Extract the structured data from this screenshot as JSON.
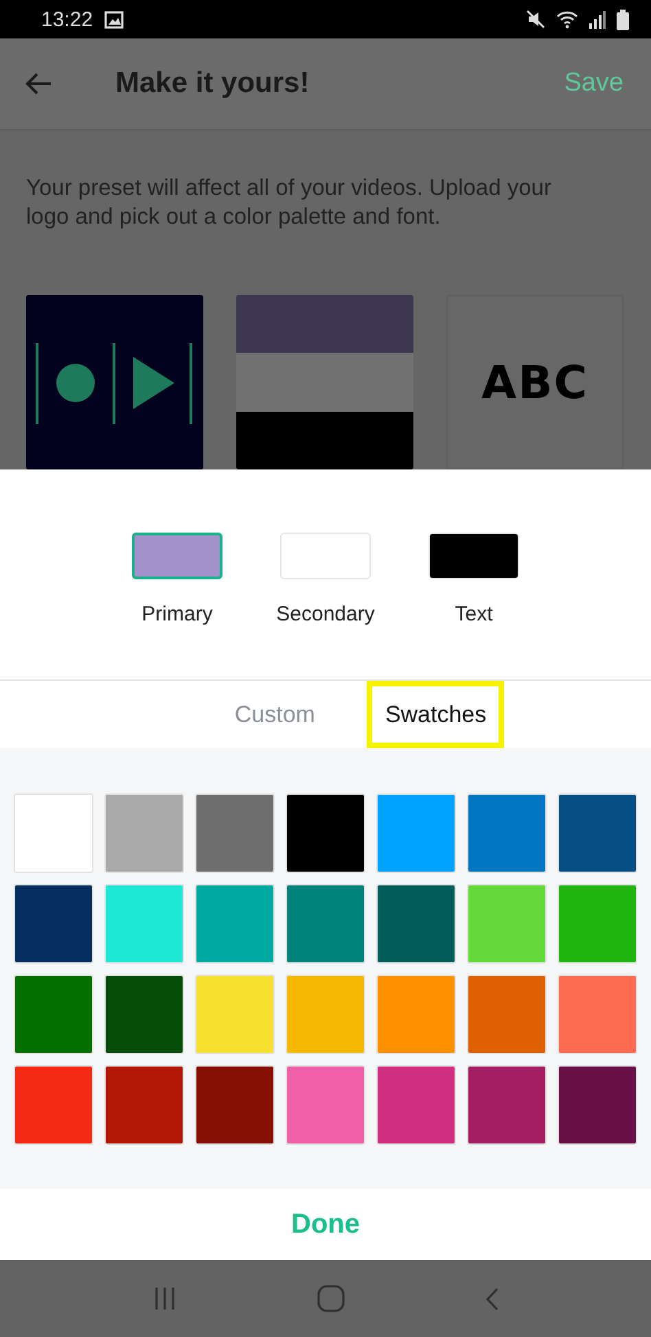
{
  "status_bar": {
    "time": "13:22"
  },
  "app_bar": {
    "title": "Make it yours!",
    "action": "Save"
  },
  "description": "Your preset will affect all of your videos. Upload your logo and pick out a color palette and font.",
  "previews": [
    {
      "kind": "logo"
    },
    {
      "kind": "palette",
      "stripes": [
        {
          "color": "#3d3651"
        },
        {
          "color": "#727272"
        },
        {
          "color": "#000000"
        }
      ]
    },
    {
      "kind": "font",
      "sample": "ABC"
    }
  ],
  "color_targets": [
    {
      "label": "Primary",
      "color": "#a292cc",
      "selected": true
    },
    {
      "label": "Secondary",
      "color": "#ffffff",
      "selected": false
    },
    {
      "label": "Text",
      "color": "#000000",
      "selected": false
    }
  ],
  "tabs": [
    {
      "label": "Custom",
      "selected": false,
      "highlighted": false
    },
    {
      "label": "Swatches",
      "selected": true,
      "highlighted": true
    }
  ],
  "swatches": [
    {
      "color": "#ffffff"
    },
    {
      "color": "#aaaaaa"
    },
    {
      "color": "#6e6e6e"
    },
    {
      "color": "#000000"
    },
    {
      "color": "#00a2ff"
    },
    {
      "color": "#0077c0"
    },
    {
      "color": "#064f85"
    },
    {
      "color": "#052f60"
    },
    {
      "color": "#1ee8d5"
    },
    {
      "color": "#00aaa0"
    },
    {
      "color": "#00827a"
    },
    {
      "color": "#005d5a"
    },
    {
      "color": "#63d93a"
    },
    {
      "color": "#1fb410"
    },
    {
      "color": "#047000"
    },
    {
      "color": "#054d08"
    },
    {
      "color": "#f8e030"
    },
    {
      "color": "#f5b800"
    },
    {
      "color": "#ff9000"
    },
    {
      "color": "#de6000"
    },
    {
      "color": "#ff6b50"
    },
    {
      "color": "#f52a14"
    },
    {
      "color": "#b31807"
    },
    {
      "color": "#851003"
    },
    {
      "color": "#f060a8"
    },
    {
      "color": "#d02e80"
    },
    {
      "color": "#a21d62"
    },
    {
      "color": "#6a1048"
    }
  ],
  "done_button": "Done"
}
